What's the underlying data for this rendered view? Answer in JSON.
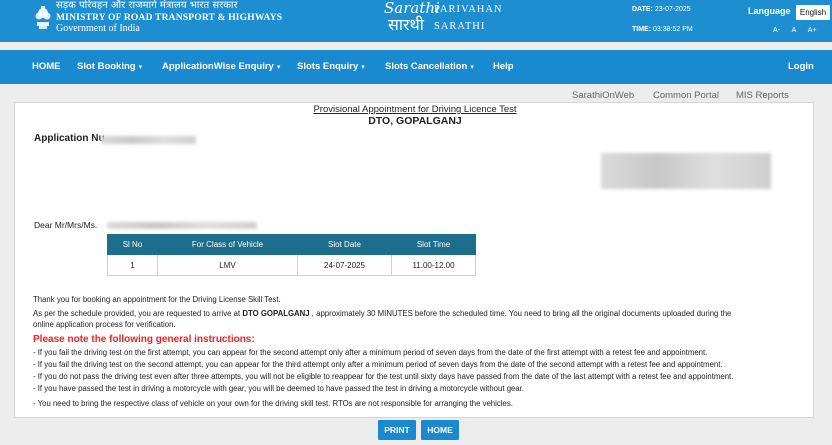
{
  "header": {
    "ministry_hindi": "सड़क परिवहन और राजमार्ग मंत्रालय भारत सरकार",
    "ministry_english": "MINISTRY OF ROAD TRANSPORT & HIGHWAYS",
    "government": "Government of India",
    "logo_script_1": "Sarathi",
    "logo_script_2": "सारथी",
    "logo_text_1": "PARIVAHAN",
    "logo_text_2": "SARATHI",
    "date_label": "DATE:",
    "date_value": "23-07-2025",
    "time_label": "TIME:",
    "time_value": "03:38:52 PM",
    "language_label": "Language",
    "language_value": "English",
    "font_small": "A-",
    "font_normal": "A",
    "font_large": "A+"
  },
  "nav": {
    "home": "HOME",
    "slot_booking": "Slot Booking",
    "applicationwise_enquiry": "ApplicationWise Enquiry",
    "slots_enquiry": "Slots Enquiry",
    "slots_cancellation": "Slots Cancellation",
    "help": "Help",
    "login": "Login",
    "caret": "▾"
  },
  "sublinks": {
    "sarathi_online": "SarathiOnWeb",
    "common_portal": "Common Portal",
    "mis_reports": "MIS Reports"
  },
  "content": {
    "title": "Provisional Appointment for Driving Licence Test",
    "office": "DTO, GOPALGANJ",
    "application_label": "Application Nu",
    "dear": "Dear Mr/Mrs/Ms.",
    "table": {
      "headers": [
        "Sl No",
        "For Class of Vehicle",
        "Slot Date",
        "Slot Time"
      ],
      "rows": [
        [
          "1",
          "LMV",
          "24-07-2025",
          "11.00-12.00"
        ]
      ]
    },
    "thanks": "Thank you for booking an appointment for the Driving License Skill Test.",
    "schedule_pre": "As per the schedule provided, you are requested to arrive at ",
    "schedule_place": "DTO GOPALGANJ",
    "schedule_post": " , approximately 30 MINUTES before the scheduled time. You need to bring all the original documents uploaded during the",
    "schedule_line2": "online application process for verification.",
    "note_heading": "Please note the following general instructions:",
    "instructions": [
      "- If you fail the driving test on the first attempt, you can appear for the second attempt only after a minimum period of seven days from the date of the first attempt with a retest fee and appointment.",
      "- If you fail the driving test on the second attempt, you can appear for the third attempt only after a minimum period of seven days from the date of the second attempt with a retest fee and appointment.",
      "- If you do not pass the driving test even after three attempts, you will not be eligible to reappear for the test until sixty days have passed from the date of the last attempt with a retest fee and appointment.",
      "- If you have passed the test in driving a motorcycle with gear, you will be deemed to have passed the test in driving a motorcycle without gear.",
      "- You need to bring the respective class of vehicle on your own for the driving skill test. RTOs are not responsible for arranging the vehicles."
    ]
  },
  "buttons": {
    "print": "PRINT",
    "home": "HOME"
  },
  "colors": {
    "header_blue": "#1d8fd0",
    "table_header": "#1d6d8c",
    "note_red": "#e22222"
  }
}
